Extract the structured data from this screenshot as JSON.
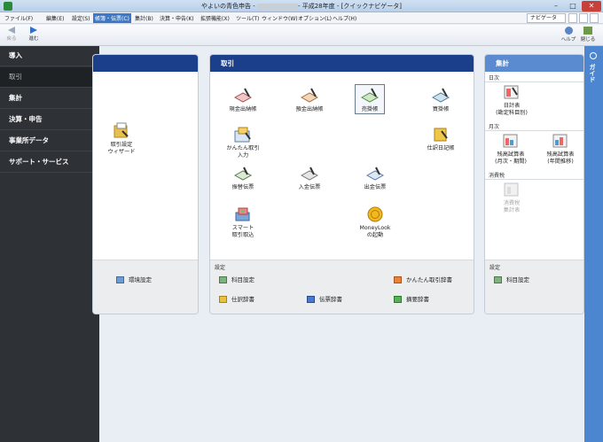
{
  "window": {
    "title_prefix": "やよいの青色申告 - ",
    "title_suffix": "- 平成28年度 - [クイックナビゲータ]",
    "minimize": "–",
    "maximize": "□",
    "close": "✕"
  },
  "menu": [
    {
      "label": "ファイル(F)",
      "active": false
    },
    {
      "label": "編集(E)",
      "active": false
    },
    {
      "label": "設定(S)",
      "active": false
    },
    {
      "label": "帳簿・伝票(C)",
      "active": true
    },
    {
      "label": "集計(B)",
      "active": false
    },
    {
      "label": "決算・申告(K)",
      "active": false
    },
    {
      "label": "拡張機能(X)",
      "active": false
    },
    {
      "label": "ツール(T)",
      "active": false
    },
    {
      "label": "ウィンドウ(W)",
      "active": false
    },
    {
      "label": "オプション(L)",
      "active": false
    },
    {
      "label": "ヘルプ(H)",
      "active": false
    }
  ],
  "navigator_button": "ナビゲータ",
  "toolbar": {
    "back": "戻る",
    "forward": "進む",
    "help": "ヘルプ",
    "close": "閉じる"
  },
  "sidebar": {
    "items": [
      {
        "label": "導入"
      },
      {
        "label": "取引"
      },
      {
        "label": "集計"
      },
      {
        "label": "決算・申告"
      },
      {
        "label": "事業所データ"
      },
      {
        "label": "サポート・サービス"
      }
    ]
  },
  "guide": {
    "label": "ガイド"
  },
  "left_panel": {
    "wizard_label_line1": "取引設定",
    "wizard_label_line2": "ウィザード",
    "env_setting": "環境設定"
  },
  "torihiki": {
    "title": "取引",
    "items": {
      "cash_book": "現金出納帳",
      "deposit_book": "預金出納帳",
      "receivable_book": "売掛帳",
      "payable_book": "買掛帳",
      "easy_entry_l1": "かんたん取引",
      "easy_entry_l2": "入力",
      "journal_book": "仕訳日記帳",
      "transfer_slip": "振替伝票",
      "deposit_slip": "入金伝票",
      "payment_slip": "出金伝票",
      "smart_l1": "スマート",
      "smart_l2": "取引取込",
      "moneylook_l1": "MoneyLook",
      "moneylook_l2": "の起動"
    },
    "settings": {
      "label": "設定",
      "account_setting": "科目設定",
      "easy_dict": "かんたん取引辞書",
      "journal_dict": "仕訳辞書",
      "slip_dict": "伝票辞書",
      "summary_dict": "摘要辞書"
    }
  },
  "shukei": {
    "title": "集計",
    "daily": "日次",
    "daily_item_l1": "日計表",
    "daily_item_l2": "(勘定科目別)",
    "monthly": "月次",
    "monthly_item1_l1": "残高試算表",
    "monthly_item1_l2": "(月次・期間)",
    "monthly_item2_l1": "残高試算表",
    "monthly_item2_l2": "(年間推移)",
    "tax": "消費税",
    "tax_item_l1": "消費税",
    "tax_item_l2": "集計表",
    "settings_label": "設定",
    "account_setting": "科目設定"
  }
}
